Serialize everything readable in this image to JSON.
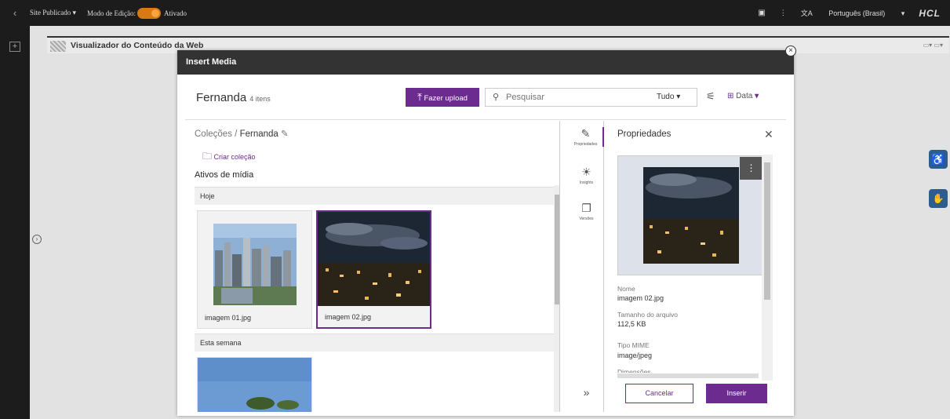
{
  "topbar": {
    "site_status": "Site Publicado",
    "edit_mode": "Modo de Edição:",
    "toggle_state": "Ativado",
    "language": "Português (Brasil)",
    "brand": "HCL"
  },
  "canvas": {
    "portlet_title": "Visualizador do Conteúdo da Web"
  },
  "modal": {
    "title": "Insert Media",
    "folder_name": "Fernanda",
    "item_count": "4 itens",
    "upload_label": "Fazer upload",
    "search_placeholder": "Pesquisar",
    "filter_value": "Tudo",
    "sort_label": "Data",
    "breadcrumb_root": "Coleções",
    "breadcrumb_sep": "/",
    "breadcrumb_current": "Fernanda",
    "create_collection": "Criar coleção",
    "assets_heading": "Ativos de mídia",
    "sections": [
      {
        "label": "Hoje"
      },
      {
        "label": "Esta semana"
      }
    ],
    "assets": [
      {
        "name": "imagem 01.jpg",
        "selected": false
      },
      {
        "name": "imagem 02.jpg",
        "selected": true
      }
    ],
    "side_tabs": [
      {
        "label": "Propriedades",
        "icon": "wrench-icon"
      },
      {
        "label": "Insights",
        "icon": "sun-icon"
      },
      {
        "label": "Versões",
        "icon": "copy-icon"
      }
    ],
    "properties": {
      "heading": "Propriedades",
      "name_label": "Nome",
      "name_value": "imagem 02.jpg",
      "size_label": "Tamanho do arquivo",
      "size_value": "112,5 KB",
      "mime_label": "Tipo MIME",
      "mime_value": "image/jpeg",
      "dims_label": "Dimensões"
    },
    "cancel_label": "Cancelar",
    "insert_label": "Inserir"
  },
  "colors": {
    "accent": "#6b2b8f",
    "toggle": "#d77a14",
    "header": "#333333"
  }
}
